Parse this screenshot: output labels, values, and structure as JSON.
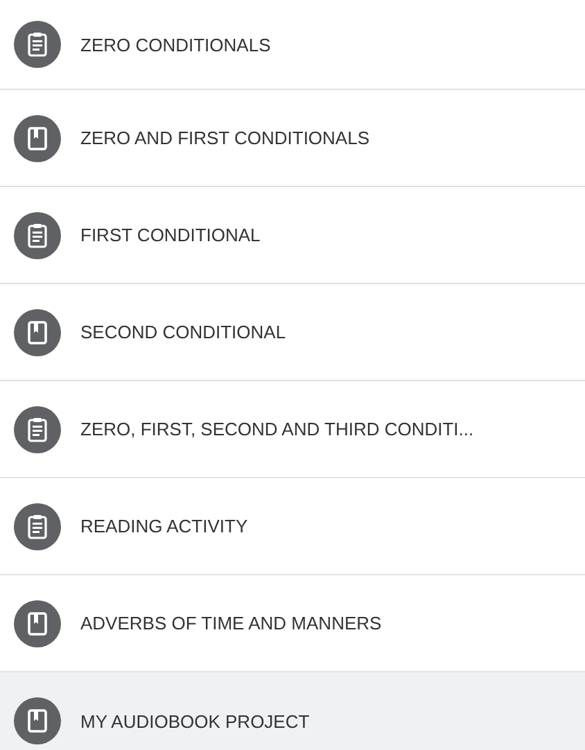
{
  "items": [
    {
      "kind": "assignment",
      "title": "ZERO CONDITIONALS",
      "selected": false
    },
    {
      "kind": "book",
      "title": "ZERO AND FIRST CONDITIONALS",
      "selected": false
    },
    {
      "kind": "assignment",
      "title": "FIRST CONDITIONAL",
      "selected": false
    },
    {
      "kind": "book",
      "title": "SECOND CONDITIONAL",
      "selected": false
    },
    {
      "kind": "assignment",
      "title": "ZERO, FIRST, SECOND AND THIRD CONDITI...",
      "selected": false
    },
    {
      "kind": "assignment",
      "title": "READING ACTIVITY",
      "selected": false
    },
    {
      "kind": "book",
      "title": "ADVERBS OF TIME AND MANNERS",
      "selected": false
    },
    {
      "kind": "book",
      "title": "MY AUDIOBOOK PROJECT",
      "selected": true
    }
  ]
}
